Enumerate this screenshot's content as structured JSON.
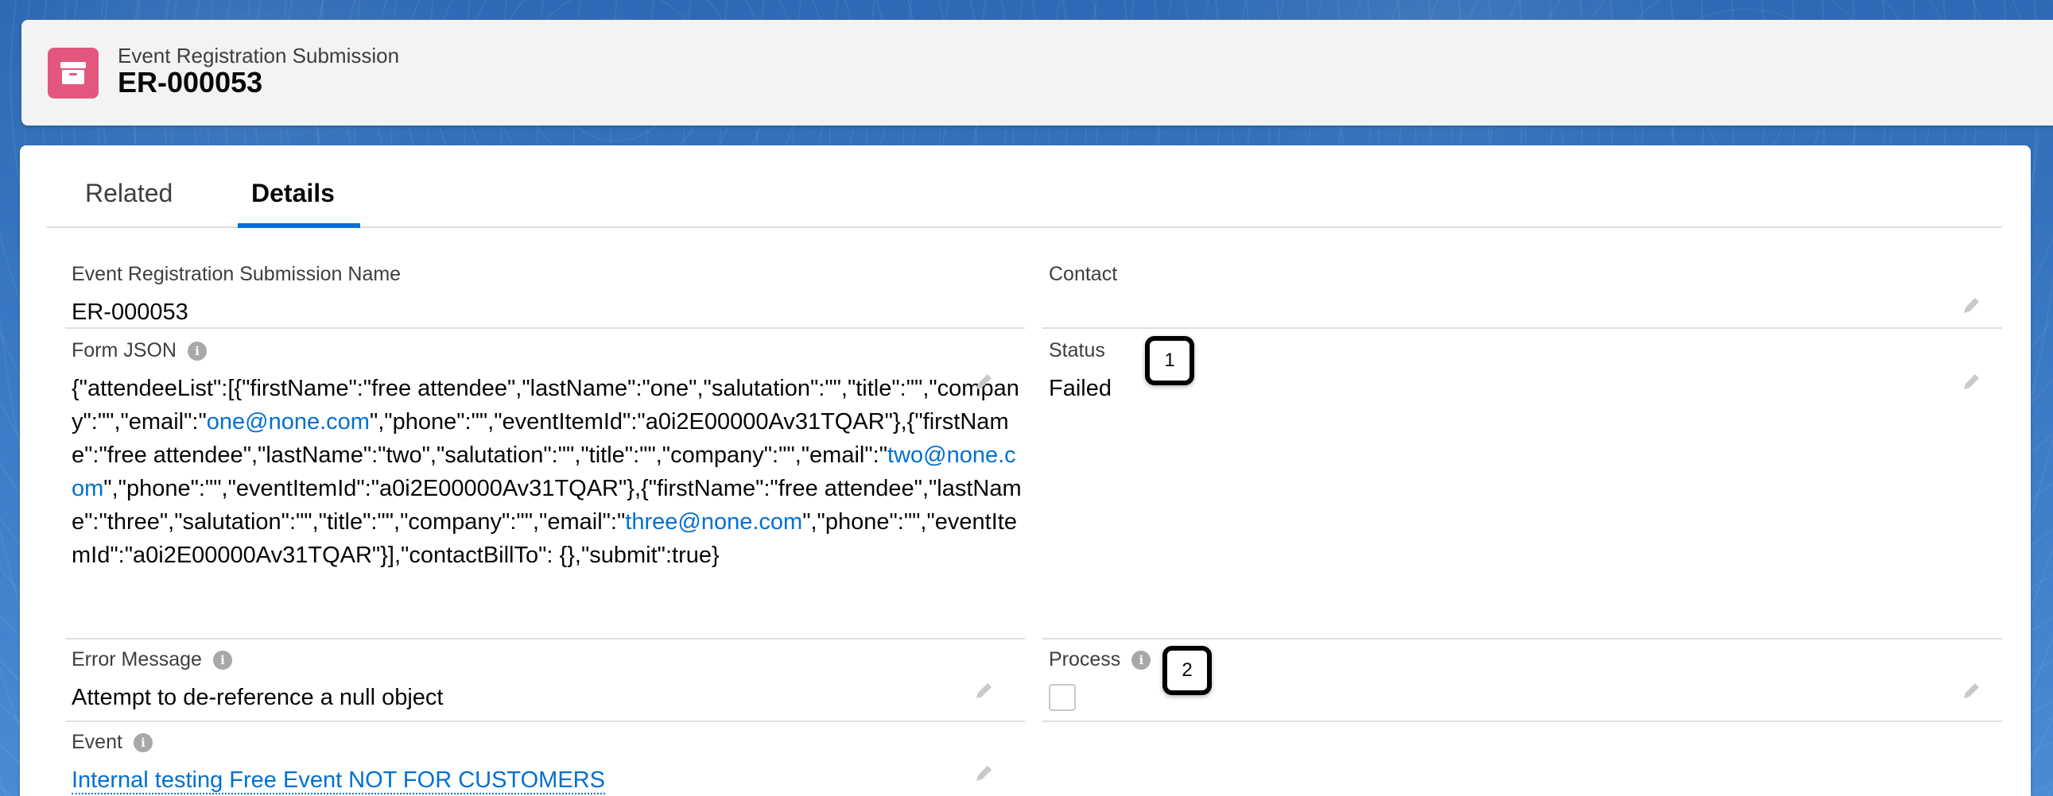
{
  "header": {
    "object_type": "Event Registration Submission",
    "record_name": "ER-000053"
  },
  "tabs": [
    {
      "label": "Related",
      "active": false
    },
    {
      "label": "Details",
      "active": true
    }
  ],
  "fields": {
    "name": {
      "label": "Event Registration Submission Name",
      "value": "ER-000053"
    },
    "contact": {
      "label": "Contact",
      "value": ""
    },
    "form_json": {
      "label": "Form JSON",
      "segments": [
        {
          "text": "{\"attendeeList\":[{\"firstName\":\"free attendee\",\"lastName\":\"one\",\"salutation\":\"\",\"title\":\"\",\"company\":\"\",\"email\":\"",
          "link": false
        },
        {
          "text": "one@none.com",
          "link": true
        },
        {
          "text": "\",\"phone\":\"\",\"eventItemId\":\"a0i2E00000Av31TQAR\"},{\"firstName\":\"free attendee\",\"lastName\":\"two\",\"salutation\":\"\",\"title\":\"\",\"company\":\"\",\"email\":\"",
          "link": false
        },
        {
          "text": "two@none.com",
          "link": true
        },
        {
          "text": "\",\"phone\":\"\",\"eventItemId\":\"a0i2E00000Av31TQAR\"},{\"firstName\":\"free attendee\",\"lastName\":\"three\",\"salutation\":\"\",\"title\":\"\",\"company\":\"\",\"email\":\"",
          "link": false
        },
        {
          "text": "three@none.com",
          "link": true
        },
        {
          "text": "\",\"phone\":\"\",\"eventItemId\":\"a0i2E00000Av31TQAR\"}],\"contactBillTo\": {},\"submit\":true}",
          "link": false
        }
      ]
    },
    "status": {
      "label": "Status",
      "value": "Failed"
    },
    "error_message": {
      "label": "Error Message",
      "value": "Attempt to de-reference a null object"
    },
    "process": {
      "label": "Process",
      "checked": false
    },
    "event": {
      "label": "Event",
      "value": "Internal testing Free Event NOT FOR CUSTOMERS"
    }
  },
  "callouts": [
    "1",
    "2"
  ],
  "colors": {
    "accent": "#0070d2",
    "icon_bg": "#e3577c"
  }
}
